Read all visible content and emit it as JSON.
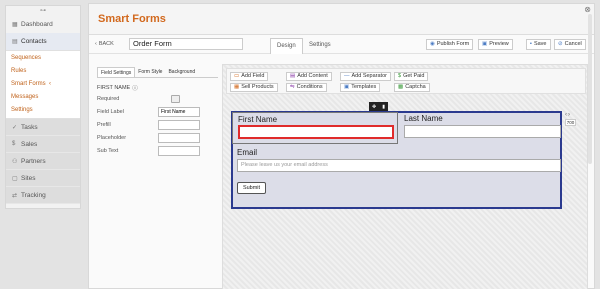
{
  "sidebar": {
    "dashboard": "Dashboard",
    "contacts": "Contacts",
    "sub_items": [
      "Sequences",
      "Rules",
      "Smart Forms",
      "Messages",
      "Settings"
    ],
    "dark_items": [
      "Tasks",
      "Sales",
      "Partners",
      "Sites",
      "Tracking"
    ]
  },
  "page": {
    "title": "Smart Forms"
  },
  "toolbar": {
    "back": "BACK",
    "form_name": "Order Form",
    "tabs": [
      "Design",
      "Settings"
    ],
    "publish": "Publish Form",
    "preview": "Preview",
    "save": "Save",
    "cancel": "Cancel"
  },
  "left_panel": {
    "tabs": [
      "Field Settings",
      "Form Style",
      "Background"
    ],
    "heading": "FIRST NAME",
    "rows": {
      "required": "Required",
      "field_label": "Field Label",
      "field_label_value": "First Name",
      "prefill": "Prefill",
      "placeholder": "Placeholder",
      "subtext": "Sub Text"
    }
  },
  "add_buttons": [
    "Add Field",
    "Add Content",
    "Add Separator",
    "Get Paid",
    "Sell Products",
    "Conditions",
    "Templates",
    "Captcha"
  ],
  "form": {
    "first_name": "First Name",
    "last_name": "Last Name",
    "email": "Email",
    "email_placeholder": "Please leave us your email address",
    "submit": "Submit"
  },
  "width_control": "700",
  "colors": {
    "accent": "#d2691e",
    "form_border": "#2b3a8f",
    "selected_field": "#e02b2b"
  }
}
